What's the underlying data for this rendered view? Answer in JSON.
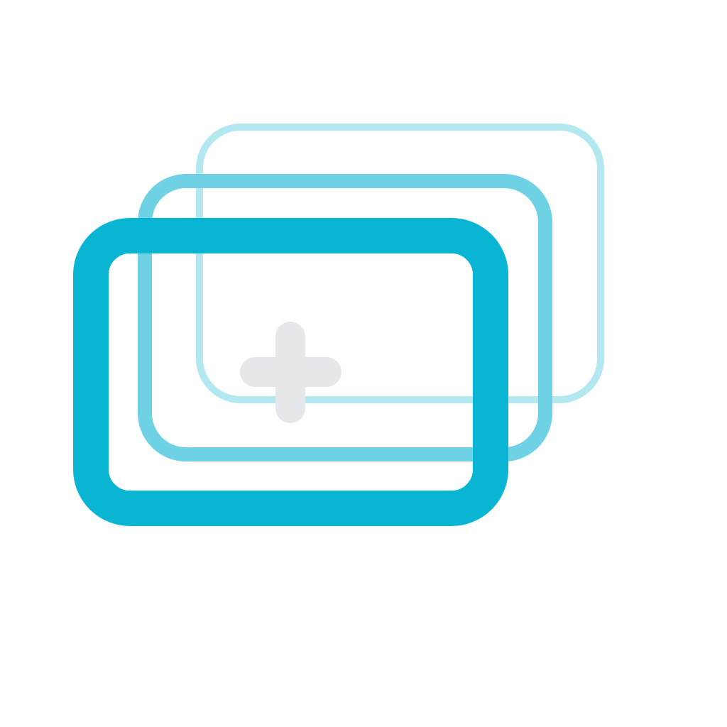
{
  "icon": {
    "name": "add-new-window-stack-icon",
    "colors": {
      "front_frame": "#0ab5d4",
      "middle_frame": "#6ed2e4",
      "back_frame": "#b3e8f1",
      "plus_sign": "#e6e7ea",
      "background": "#ffffff"
    }
  }
}
